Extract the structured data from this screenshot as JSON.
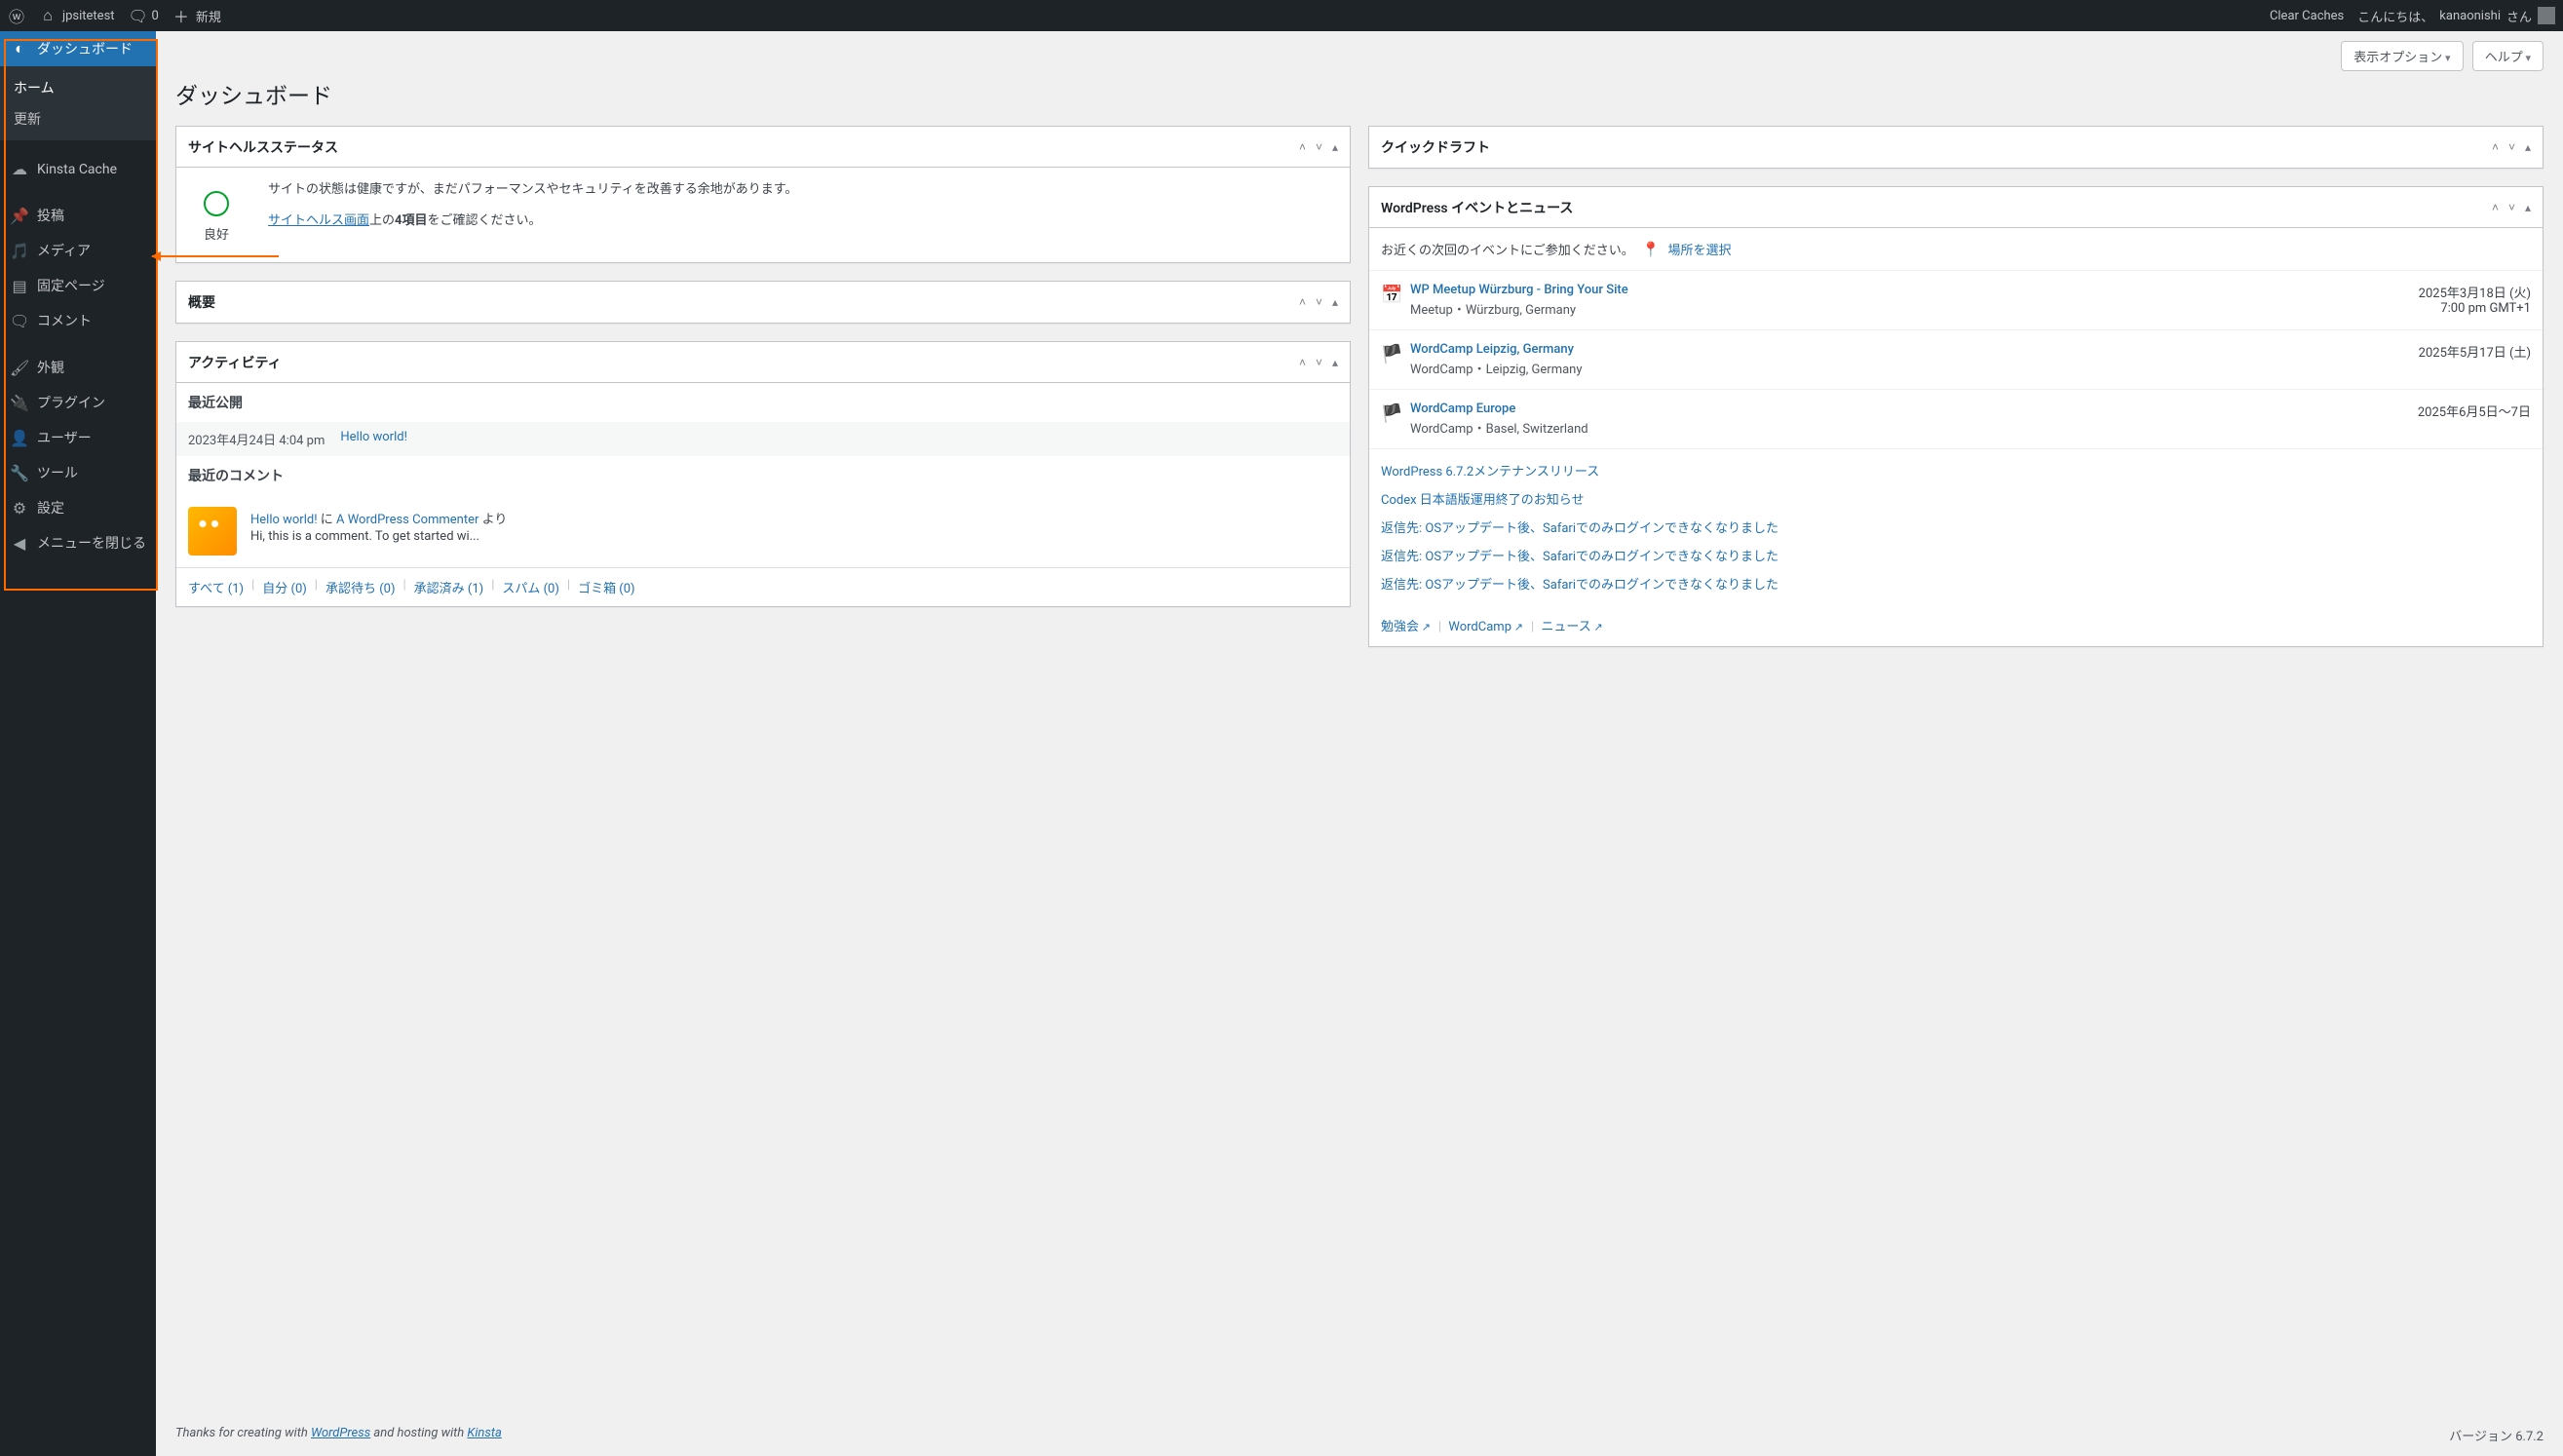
{
  "adminbar": {
    "site_name": "jpsitetest",
    "comments_count": "0",
    "new_label": "新規",
    "clear_caches": "Clear Caches",
    "howdy_prefix": "こんにちは、",
    "user": "kanaonishi",
    "howdy_suffix": " さん"
  },
  "screen_meta": {
    "options": "表示オプション",
    "help": "ヘルプ"
  },
  "page_title": "ダッシュボード",
  "sidebar": {
    "dashboard": "ダッシュボード",
    "home": "ホーム",
    "updates": "更新",
    "kinsta": "Kinsta Cache",
    "posts": "投稿",
    "media": "メディア",
    "pages": "固定ページ",
    "comments": "コメント",
    "appearance": "外観",
    "plugins": "プラグイン",
    "users": "ユーザー",
    "tools": "ツール",
    "settings": "設定",
    "collapse": "メニューを閉じる"
  },
  "site_health": {
    "title": "サイトヘルスステータス",
    "status_label": "良好",
    "desc": "サイトの状態は健康ですが、まだパフォーマンスやセキュリティを改善する余地があります。",
    "link": "サイトヘルス画面",
    "after_link_1": "上の",
    "bold": "4項目",
    "after_link_2": "をご確認ください。"
  },
  "overview": {
    "title": "概要"
  },
  "activity": {
    "title": "アクティビティ",
    "recent_published": "最近公開",
    "post_date": "2023年4月24日 4:04 pm",
    "post_title": "Hello world!",
    "recent_comments": "最近のコメント",
    "comment_on": "Hello world!",
    "comment_to": " に ",
    "comment_author": "A WordPress Commenter",
    "comment_from": " より",
    "comment_text": "Hi, this is a comment. To get started wi...",
    "footer": {
      "all": "すべて (1)",
      "mine": "自分 (0)",
      "pending": "承認待ち (0)",
      "approved": "承認済み (1)",
      "spam": "スパム (0)",
      "trash": "ゴミ箱 (0)"
    }
  },
  "quickdraft": {
    "title": "クイックドラフト"
  },
  "events": {
    "title": "WordPress イベントとニュース",
    "prompt": "お近くの次回のイベントにご参加ください。",
    "select_location": "場所を選択",
    "items": [
      {
        "title": "WP Meetup Würzburg - Bring Your Site",
        "meta": "Meetup・Würzburg, Germany",
        "date": "2025年3月18日 (火)",
        "time": "7:00 pm GMT+1",
        "icon": "calendar"
      },
      {
        "title": "WordCamp Leipzig, Germany",
        "meta": "WordCamp・Leipzig, Germany",
        "date": "2025年5月17日 (土)",
        "time": "",
        "icon": "wordcamp"
      },
      {
        "title": "WordCamp Europe",
        "meta": "WordCamp・Basel, Switzerland",
        "date": "2025年6月5日〜7日",
        "time": "",
        "icon": "wordcamp"
      }
    ],
    "news": [
      "WordPress 6.7.2メンテナンスリリース",
      "Codex 日本語版運用終了のお知らせ",
      "返信先: OSアップデート後、Safariでのみログインできなくなりました",
      "返信先: OSアップデート後、Safariでのみログインできなくなりました",
      "返信先: OSアップデート後、Safariでのみログインできなくなりました"
    ],
    "footer": {
      "meetup": "勉強会",
      "wordcamp": "WordCamp",
      "news": "ニュース"
    }
  },
  "footer": {
    "text_1": "Thanks for creating with ",
    "wp": "WordPress",
    "text_2": " and hosting with ",
    "kinsta": "Kinsta",
    "version": "バージョン 6.7.2"
  }
}
